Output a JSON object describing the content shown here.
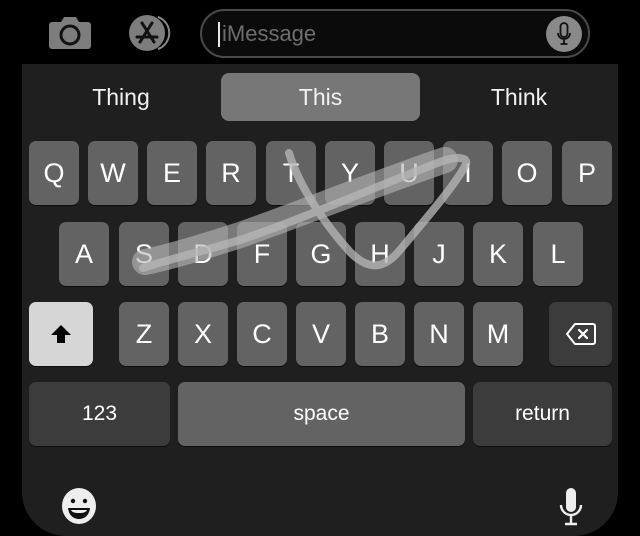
{
  "input_bar": {
    "camera_icon": "camera-icon",
    "appstore_icon": "app-store-icon",
    "message_placeholder": "iMessage",
    "message_value": "",
    "mic_icon": "microphone-icon"
  },
  "suggestions": [
    {
      "label": "Thing",
      "selected": false
    },
    {
      "label": "This",
      "selected": true
    },
    {
      "label": "Think",
      "selected": false
    }
  ],
  "keyboard": {
    "row1": [
      "Q",
      "W",
      "E",
      "R",
      "T",
      "Y",
      "U",
      "I",
      "O",
      "P"
    ],
    "row2": [
      "A",
      "S",
      "D",
      "F",
      "G",
      "H",
      "J",
      "K",
      "L"
    ],
    "row3": [
      "Z",
      "X",
      "C",
      "V",
      "B",
      "N",
      "M"
    ],
    "shift_icon": "shift-icon",
    "shift_active": true,
    "delete_icon": "delete-icon",
    "numbers_label": "123",
    "space_label": "space",
    "return_label": "return",
    "emoji_icon": "emoji-icon",
    "dictation_icon": "microphone-icon"
  },
  "swipe_trail": {
    "path_keys": [
      "T",
      "G",
      "H",
      "I",
      "S"
    ],
    "predicted_word": "This"
  },
  "colors": {
    "keyboard_bg": "#1f1f1f",
    "letter_key": "#636363",
    "function_key": "#3c3c3c",
    "shift_key_active": "#d6d6d6",
    "suggestion_selected": "#777777"
  }
}
